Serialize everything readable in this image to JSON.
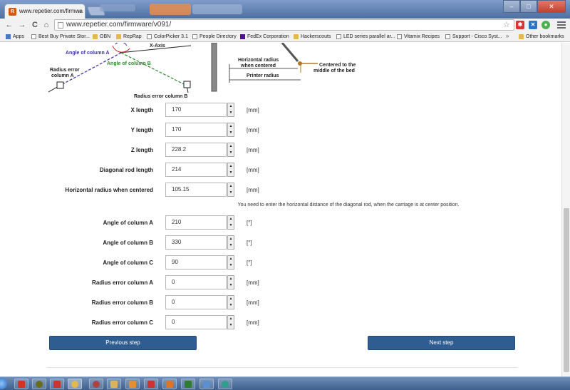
{
  "browser": {
    "tab_title": "www.repetier.com/firmwa",
    "tab_close": "×",
    "url": "www.repetier.com/firmware/v091/",
    "nav": {
      "back": "←",
      "forward": "→",
      "reload": "C",
      "home": "⌂"
    },
    "star": "☆"
  },
  "bookmarks": [
    {
      "label": "Apps",
      "icon": "apps"
    },
    {
      "label": "Best Buy Private Stor...",
      "icon": "doc"
    },
    {
      "label": "OBN",
      "icon": "folder"
    },
    {
      "label": "RepRap",
      "icon": "folder"
    },
    {
      "label": "ColorPicker 3.1",
      "icon": "doc"
    },
    {
      "label": "People Directory",
      "icon": "doc"
    },
    {
      "label": "FedEx Corporation",
      "icon": "fedex"
    },
    {
      "label": "Hackerscouts",
      "icon": "folder"
    },
    {
      "label": "LED series parallel ar...",
      "icon": "doc"
    },
    {
      "label": "Vitamix Recipes",
      "icon": "doc"
    },
    {
      "label": "Support - Cisco Syst...",
      "icon": "doc"
    },
    {
      "label": "»",
      "icon": "none"
    },
    {
      "label": "Other bookmarks",
      "icon": "folder"
    }
  ],
  "diagram": {
    "x_axis": "X-Axis",
    "angle_a": "Angle of column A",
    "angle_b": "Angle of column B",
    "radius_error_a_line1": "Radius error",
    "radius_error_a_line2": "column A",
    "radius_error_b": "Radius error column B",
    "horizontal_radius_line1": "Horizontal radius",
    "horizontal_radius_line2": "when centered",
    "printer_radius": "Printer radius",
    "centered_line1": "Centered to the",
    "centered_line2": "middle of the bed"
  },
  "fields": [
    {
      "label": "X length",
      "value": "170",
      "unit": "[mm]"
    },
    {
      "label": "Y length",
      "value": "170",
      "unit": "[mm]"
    },
    {
      "label": "Z length",
      "value": "228.2",
      "unit": "[mm]"
    },
    {
      "label": "Diagonal rod length",
      "value": "214",
      "unit": "[mm]"
    },
    {
      "label": "Horizontal radius when centered",
      "value": "105.15",
      "unit": "[mm]"
    }
  ],
  "hint": "You need to enter the horizontal distance of the diagonal rod, when the carriage is at center position.",
  "fields2": [
    {
      "label": "Angle of column A",
      "value": "210",
      "unit": "[°]"
    },
    {
      "label": "Angle of column B",
      "value": "330",
      "unit": "[°]"
    },
    {
      "label": "Angle of column C",
      "value": "90",
      "unit": "[°]"
    },
    {
      "label": "Radius error column A",
      "value": "0",
      "unit": "[mm]"
    },
    {
      "label": "Radius error column B",
      "value": "0",
      "unit": "[mm]"
    },
    {
      "label": "Radius error column C",
      "value": "0",
      "unit": "[mm]"
    }
  ],
  "spinner": {
    "up": "▲",
    "down": "▼"
  },
  "buttons": {
    "previous": "Previous step",
    "next": "Next step"
  },
  "colors": {
    "primary_button": "#2f5c91",
    "angle_a": "#3b2fa4",
    "angle_b": "#2e8b2e",
    "axis_red": "#cc2222"
  }
}
